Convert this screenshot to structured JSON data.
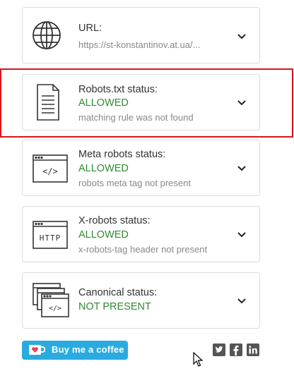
{
  "cards": [
    {
      "title": "URL:",
      "sub": "https://st-konstantinov.at.ua/...",
      "icon": "globe-icon"
    },
    {
      "title": "Robots.txt status:",
      "status": "ALLOWED",
      "sub": "matching rule was not found",
      "icon": "document-icon"
    },
    {
      "title": "Meta robots status:",
      "status": "ALLOWED",
      "sub": "robots meta tag not present",
      "icon": "code-window-icon"
    },
    {
      "title": "X-robots status:",
      "status": "ALLOWED",
      "sub": "x-robots-tag header not present",
      "icon": "http-window-icon"
    },
    {
      "title": "Canonical status:",
      "status": "NOT PRESENT",
      "icon": "stacked-windows-icon"
    }
  ],
  "http_label": "HTTP",
  "code_label": "</>",
  "coffee": {
    "label": "Buy me a coffee"
  },
  "social": [
    "twitter-icon",
    "facebook-icon",
    "linkedin-icon"
  ],
  "colors": {
    "status_green": "#2e8b2e",
    "highlight_red": "#d6161b",
    "coffee_blue": "#29abe0"
  }
}
